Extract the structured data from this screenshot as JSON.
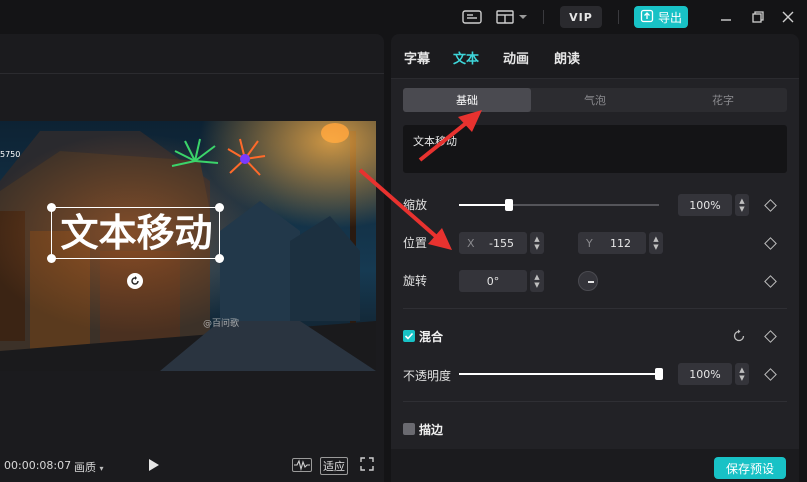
{
  "window": {
    "vip_label": "VIP",
    "export_label": "导出",
    "icons": [
      "subtitle-icon",
      "layout-icon",
      "chevron-down-icon",
      "upload-icon",
      "minimize-icon",
      "restore-icon",
      "close-icon"
    ]
  },
  "preview": {
    "overlay_text": "文本移动",
    "corner_text": "5750",
    "watermark_text": "@百问歌"
  },
  "player": {
    "timecode": "00:00:08:07",
    "quality_label": "画质",
    "fit_label": "适应",
    "icons": [
      "play-icon",
      "waveform-icon",
      "fullscreen-icon"
    ]
  },
  "panel": {
    "tabs": [
      {
        "label": "字幕",
        "active": false
      },
      {
        "label": "文本",
        "active": true
      },
      {
        "label": "动画",
        "active": false
      },
      {
        "label": "朗读",
        "active": false
      }
    ],
    "segments": [
      {
        "label": "基础",
        "active": true
      },
      {
        "label": "气泡",
        "active": false
      },
      {
        "label": "花字",
        "active": false
      }
    ],
    "text_value": "文本移动",
    "scale": {
      "label": "缩放",
      "value": "100%",
      "level": 0.25
    },
    "position": {
      "label": "位置",
      "x_label": "X",
      "x_value": "-155",
      "y_label": "Y",
      "y_value": "112"
    },
    "rotation": {
      "label": "旋转",
      "value": "0°"
    },
    "blend": {
      "label": "混合",
      "checked": true
    },
    "opacity": {
      "label": "不透明度",
      "value": "100%",
      "level": 1.0
    },
    "stroke": {
      "label": "描边",
      "checked": false
    },
    "save_preset_label": "保存预设"
  },
  "colors": {
    "accent": "#18c2c6",
    "accent_text": "#3ed6da",
    "arrow": "#e8322f"
  }
}
